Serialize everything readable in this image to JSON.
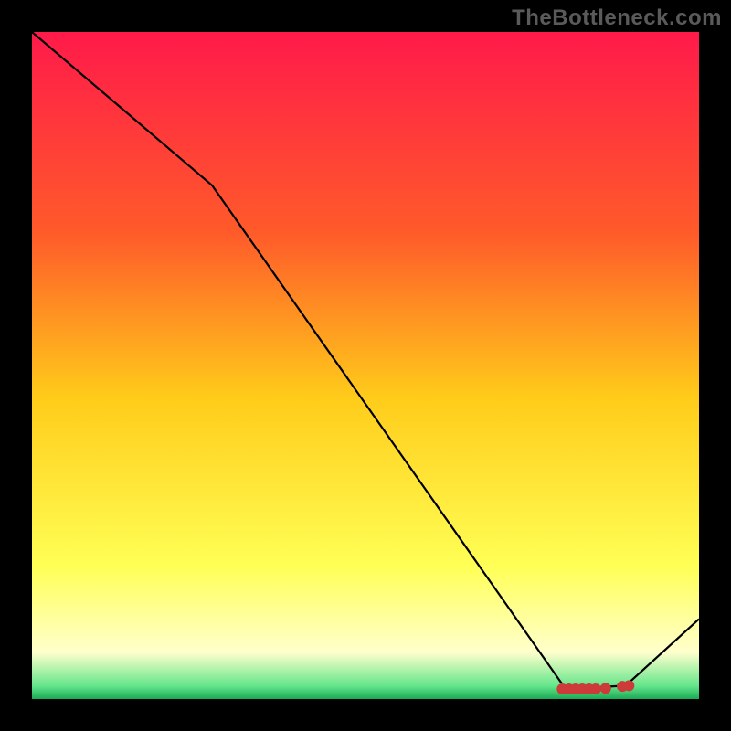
{
  "watermark": "TheBottleneck.com",
  "chart_data": {
    "type": "line",
    "title": "",
    "xlabel": "",
    "ylabel": "",
    "xlim": [
      0,
      100
    ],
    "ylim": [
      0,
      100
    ],
    "grid": false,
    "legend": false,
    "series": [
      {
        "name": "bottleneck-curve",
        "color": "#000000",
        "x": [
          0,
          27,
          80,
          89,
          100
        ],
        "values": [
          100,
          77,
          1.5,
          2,
          12
        ]
      }
    ],
    "markers": {
      "name": "optimal-markers",
      "color": "#cc3a3a",
      "x": [
        79.5,
        80.5,
        81.5,
        82.5,
        83.5,
        84.5,
        86,
        88.5,
        89.5
      ],
      "y": [
        1.5,
        1.5,
        1.5,
        1.5,
        1.5,
        1.5,
        1.6,
        1.9,
        2.0
      ]
    },
    "background": {
      "type": "vertical-gradient",
      "stops": [
        {
          "pos": 0,
          "color": "#ff1a4a"
        },
        {
          "pos": 30,
          "color": "#ff5a2a"
        },
        {
          "pos": 55,
          "color": "#ffcc1a"
        },
        {
          "pos": 80,
          "color": "#ffff55"
        },
        {
          "pos": 93,
          "color": "#ffffcc"
        },
        {
          "pos": 98,
          "color": "#66e68c"
        },
        {
          "pos": 100,
          "color": "#1aab55"
        }
      ]
    }
  }
}
